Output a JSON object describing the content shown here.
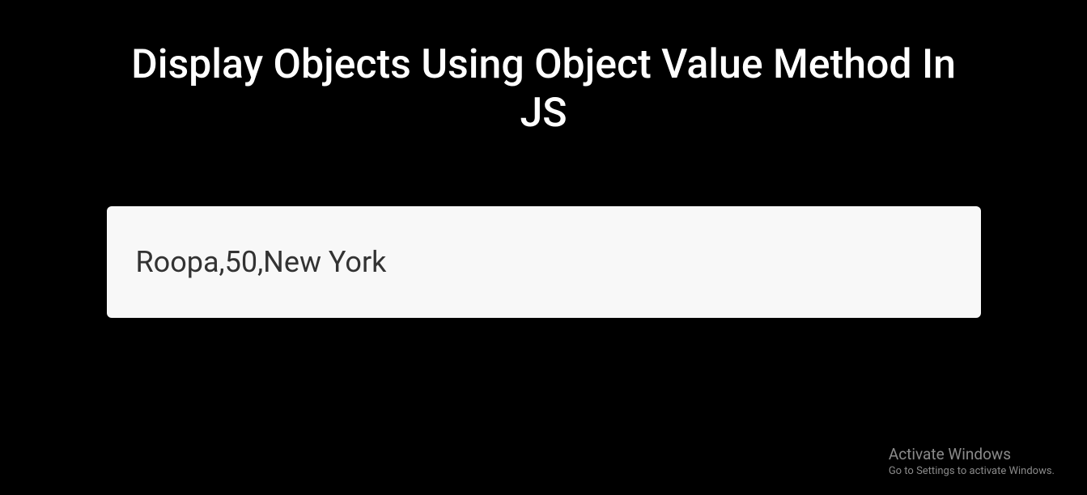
{
  "heading": "Display Objects Using Object Value Method In JS",
  "output": "Roopa,50,New York",
  "watermark": {
    "title": "Activate Windows",
    "subtitle": "Go to Settings to activate Windows."
  }
}
